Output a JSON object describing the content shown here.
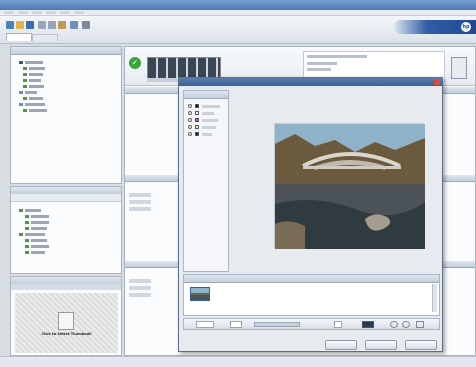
{
  "app": {
    "title": "",
    "menu": [
      "",
      "",
      "",
      "",
      "",
      ""
    ],
    "tabs": [
      "",
      ""
    ],
    "brand": {
      "logo_text": "hp",
      "banner_text": ""
    },
    "accent": "#2f5da6",
    "title_color": "#4e78b3"
  },
  "left": {
    "panels": [
      {
        "header": ""
      },
      {
        "header": ""
      },
      {
        "header": ""
      }
    ],
    "preview_caption": "Click to Select Thumbnail"
  },
  "main": {
    "header_text": "",
    "info_lines": [
      "",
      "",
      ""
    ],
    "section_headers": [
      "",
      "",
      ""
    ],
    "list_items": [
      "",
      "",
      "",
      "",
      "",
      ""
    ]
  },
  "dialog": {
    "title": "",
    "options_header": "",
    "options": [
      {
        "label": "",
        "color": "#111111"
      },
      {
        "label": "",
        "color": "#f2f2f2"
      },
      {
        "label": "",
        "color": "#d53ad0"
      },
      {
        "label": "",
        "color": "#f2ec7a"
      },
      {
        "label": "",
        "color": "#1a1a1a"
      }
    ],
    "filmstrip_header": "",
    "zoom_value": "",
    "buttons": {
      "back": "",
      "next": "",
      "cancel": ""
    }
  }
}
